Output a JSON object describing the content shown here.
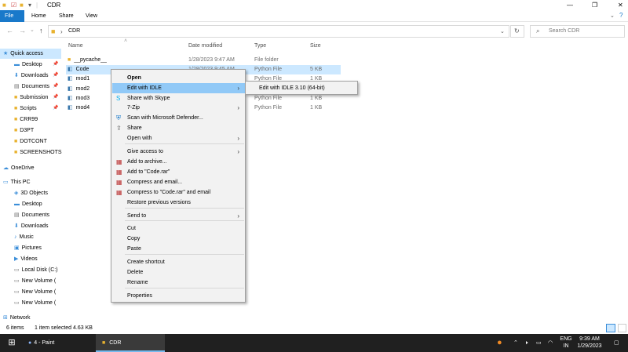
{
  "window": {
    "title": "CDR",
    "controls": [
      "—",
      "❐",
      "✕"
    ]
  },
  "ribbon": {
    "tabs": [
      "File",
      "Home",
      "Share",
      "View"
    ]
  },
  "address": {
    "path": "CDR",
    "search_placeholder": "Search CDR"
  },
  "sidebar": {
    "items": [
      {
        "label": "Quick access",
        "icon": "star-icon"
      },
      {
        "label": "Desktop",
        "icon": "desktop-icon",
        "pinned": true
      },
      {
        "label": "Downloads",
        "icon": "downloads-icon",
        "pinned": true
      },
      {
        "label": "Documents",
        "icon": "documents-icon",
        "pinned": true
      },
      {
        "label": "Submission",
        "icon": "folder-icon",
        "pinned": true
      },
      {
        "label": "Scripts",
        "icon": "folder-icon",
        "pinned": true
      },
      {
        "label": "CRR99",
        "icon": "folder-icon"
      },
      {
        "label": "D3PT",
        "icon": "folder-icon"
      },
      {
        "label": "DOTCONT",
        "icon": "folder-icon"
      },
      {
        "label": "SCREENSHOTS",
        "icon": "folder-icon"
      },
      {
        "label": "OneDrive",
        "icon": "cloud-icon"
      },
      {
        "label": "This PC",
        "icon": "pc-icon"
      },
      {
        "label": "3D Objects",
        "icon": "cube-icon"
      },
      {
        "label": "Desktop",
        "icon": "desktop-icon"
      },
      {
        "label": "Documents",
        "icon": "documents-icon"
      },
      {
        "label": "Downloads",
        "icon": "downloads-icon"
      },
      {
        "label": "Music",
        "icon": "music-icon"
      },
      {
        "label": "Pictures",
        "icon": "pictures-icon"
      },
      {
        "label": "Videos",
        "icon": "videos-icon"
      },
      {
        "label": "Local Disk (C:)",
        "icon": "disk-icon"
      },
      {
        "label": "New Volume (",
        "icon": "disk-icon"
      },
      {
        "label": "New Volume (",
        "icon": "disk-icon"
      },
      {
        "label": "New Volume (",
        "icon": "disk-icon"
      },
      {
        "label": "Network",
        "icon": "network-icon"
      }
    ]
  },
  "columns": [
    "Name",
    "Date modified",
    "Type",
    "Size"
  ],
  "files": [
    {
      "name": "__pycache__",
      "date": "1/28/2023 9:47 AM",
      "type": "File folder",
      "size": ""
    },
    {
      "name": "Code",
      "date": "1/28/2023 9:45 AM",
      "type": "Python File",
      "size": "5 KB"
    },
    {
      "name": "mod1",
      "date": "",
      "type": "Python File",
      "size": "1 KB"
    },
    {
      "name": "mod2",
      "date": "",
      "type": "Python File",
      "size": "1 KB"
    },
    {
      "name": "mod3",
      "date": "",
      "type": "Python File",
      "size": "1 KB"
    },
    {
      "name": "mod4",
      "date": "",
      "type": "Python File",
      "size": "1 KB"
    }
  ],
  "context_menu": {
    "items": [
      "Open",
      "Edit with IDLE",
      "Share with Skype",
      "7-Zip",
      "Scan with Microsoft Defender...",
      "Share",
      "Open with",
      "Give access to",
      "Add to archive...",
      "Add to \"Code.rar\"",
      "Compress and email...",
      "Compress to \"Code.rar\" and email",
      "Restore previous versions",
      "Send to",
      "Cut",
      "Copy",
      "Paste",
      "Create shortcut",
      "Delete",
      "Rename",
      "Properties"
    ],
    "submenu_item": "Edit with IDLE 3.10 (64-bit)"
  },
  "status": {
    "count": "6 items",
    "selection": "1 item selected  4.63 KB"
  },
  "taskbar": {
    "paint_label": "4 - Paint",
    "explorer_label": "CDR",
    "lang": "ENG",
    "lang_region": "IN",
    "time": "9:39 AM",
    "date": "1/29/2023"
  }
}
